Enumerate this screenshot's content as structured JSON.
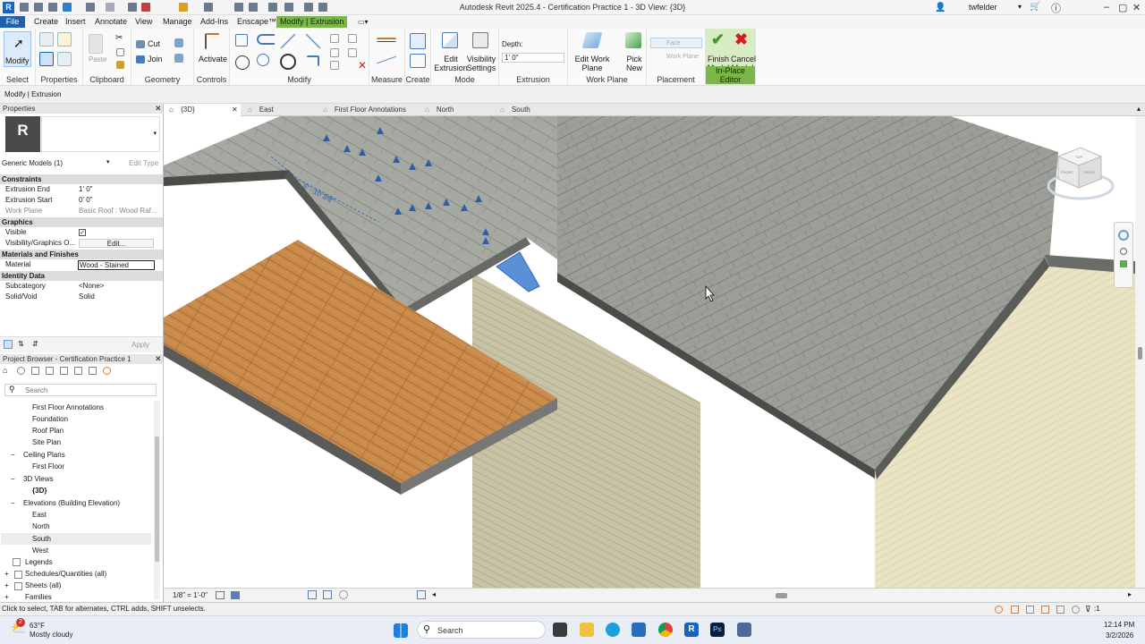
{
  "window": {
    "title": "Autodesk Revit 2025.4 - Certification Practice 1 - 3D View: {3D}",
    "username": "twfelder"
  },
  "ribbon_tabs": [
    "File",
    "Create",
    "Insert",
    "Annotate",
    "View",
    "Manage",
    "Add-Ins",
    "Enscape™",
    "Modify | Extrusion"
  ],
  "ribbon": {
    "modify": "Modify",
    "paste": "Paste",
    "cut": "Cut",
    "join": "Join",
    "activate": "Activate",
    "edit_extrusion": "Edit Extrusion",
    "visibility_settings": "Visibility Settings",
    "depth_label": "Depth:",
    "depth_value": "1'  0\"",
    "edit_work_plane": "Edit Work Plane",
    "pick_new": "Pick New",
    "face": "Face",
    "work_plane": "Work Plane",
    "finish_model": "Finish Model",
    "cancel_model": "Cancel Model",
    "panels": {
      "select": "Select",
      "properties": "Properties",
      "clipboard": "Clipboard",
      "geometry": "Geometry",
      "controls": "Controls",
      "modify": "Modify",
      "measure": "Measure",
      "create": "Create",
      "mode": "Mode",
      "extrusion": "Extrusion",
      "work_plane": "Work Plane",
      "placement": "Placement",
      "in_place_editor": "In-Place Editor"
    }
  },
  "context_label": "Modify | Extrusion",
  "properties": {
    "title": "Properties",
    "type_selector": "Generic Models (1)",
    "edit_type": "Edit Type",
    "sections": {
      "constraints": "Constraints",
      "graphics": "Graphics",
      "materials": "Materials and Finishes",
      "identity": "Identity Data"
    },
    "rows": {
      "extrusion_end_k": "Extrusion End",
      "extrusion_end_v": "1'  0\"",
      "extrusion_start_k": "Extrusion Start",
      "extrusion_start_v": "0'  0\"",
      "work_plane_k": "Work Plane",
      "work_plane_v": "Basic Roof : Wood Raf...",
      "visible_k": "Visible",
      "vg_k": "Visibility/Graphics O...",
      "vg_v": "Edit...",
      "material_k": "Material",
      "material_v": "Wood - Stained",
      "subcategory_k": "Subcategory",
      "subcategory_v": "<None>",
      "solidvoid_k": "Solid/Void",
      "solidvoid_v": "Solid"
    },
    "apply": "Apply"
  },
  "browser": {
    "title": "Project Browser - Certification Practice 1",
    "search_placeholder": "Search",
    "nodes": [
      "First Floor Annotations",
      "Foundation",
      "Roof Plan",
      "Site Plan",
      "Ceiling Plans",
      "First Floor",
      "3D Views",
      "{3D}",
      "Elevations (Building Elevation)",
      "East",
      "North",
      "South",
      "West",
      "Legends",
      "Schedules/Quantities (all)",
      "Sheets (all)",
      "Families"
    ]
  },
  "view_tabs": [
    "{3D}",
    "East",
    "First Floor Annotations",
    "North",
    "South"
  ],
  "viewport": {
    "dimension": "6' - 10 3/8\"",
    "cube_top": "TOP",
    "cube_front": "FRONT",
    "cube_right": "RIGHT"
  },
  "view_control": {
    "scale": "1/8\" = 1'-0\""
  },
  "status": {
    "message": "Click to select, TAB for alternates, CTRL adds, SHIFT unselects.",
    "filter_count": ":1"
  },
  "taskbar": {
    "temp": "63°F",
    "weather": "Mostly cloudy",
    "badge": "2",
    "search": "Search",
    "time": "12:14 PM",
    "date": "3/2/2026"
  },
  "colors": {
    "accent": "#1e5fae",
    "context_tab": "#7ab648",
    "roof": "#9a9c96",
    "deck": "#c98a4b",
    "siding_light": "#ebe4c4"
  }
}
